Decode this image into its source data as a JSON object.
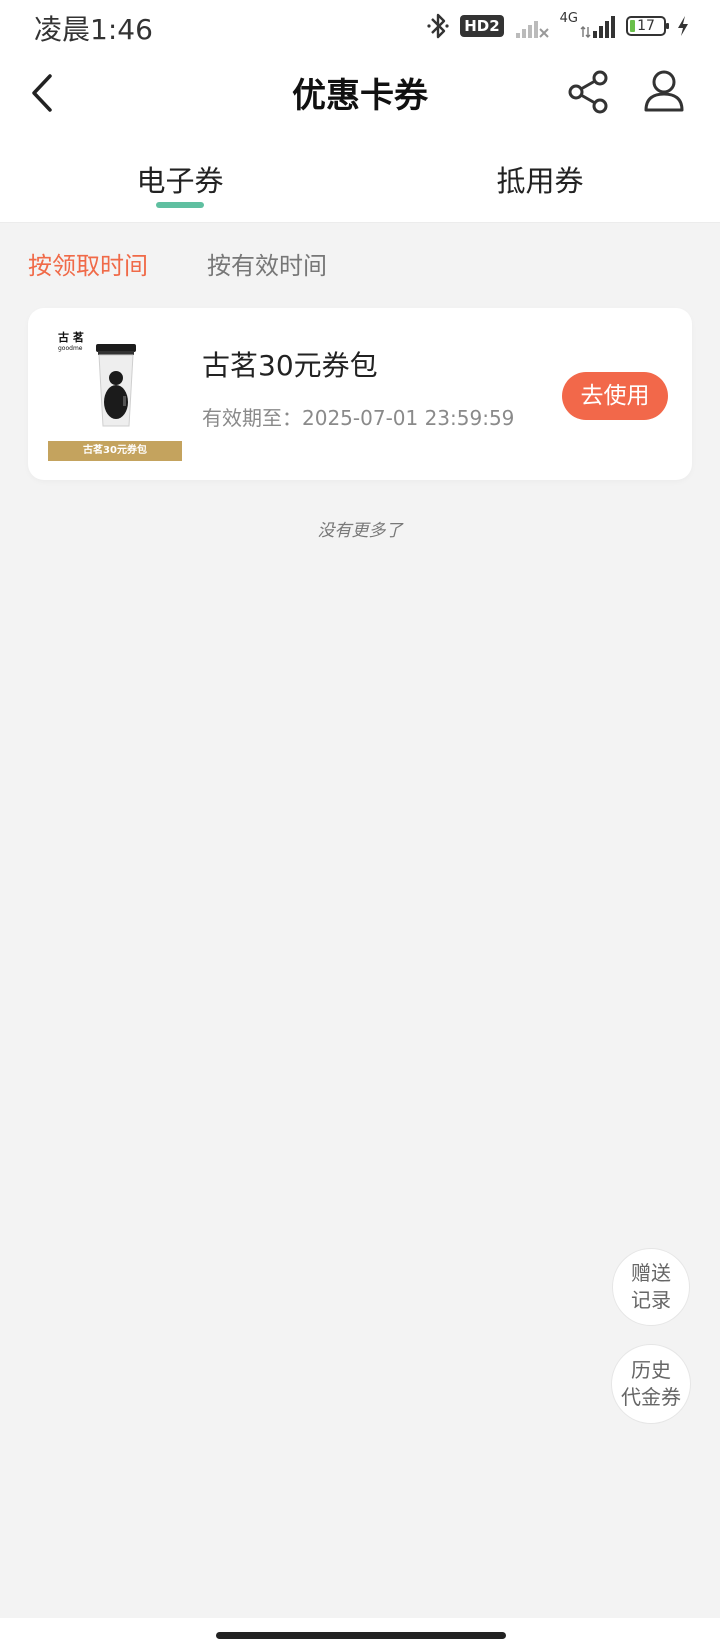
{
  "status_bar": {
    "time": "凌晨1:46",
    "hd_badge": "HD2",
    "network": "4G",
    "battery": "17",
    "icons": [
      "bluetooth-icon",
      "signal-icon",
      "battery-icon",
      "charging-icon"
    ]
  },
  "header": {
    "title": "优惠卡券",
    "icons": [
      "back-icon",
      "share-icon",
      "user-icon"
    ]
  },
  "tabs": [
    {
      "label": "电子券",
      "active": true
    },
    {
      "label": "抵用券",
      "active": false
    }
  ],
  "sort": {
    "options": [
      {
        "label": "按领取时间",
        "active": true
      },
      {
        "label": "按有效时间",
        "active": false
      }
    ]
  },
  "coupons": [
    {
      "title": "古茗30元券包",
      "expiry": "有效期至：2025-07-01 23:59:59",
      "button": "去使用",
      "thumb_brand": "古 茗",
      "thumb_brand_en": "goodme",
      "thumb_banner": "古茗30元券包"
    }
  ],
  "list_end_text": "没有更多了",
  "floating": {
    "gift_record": [
      "赠送",
      "记录"
    ],
    "history": [
      "历史",
      "代金券"
    ]
  },
  "colors": {
    "accent": "#f2684a",
    "tab_indicator": "#5fbfa0",
    "background": "#f3f3f3"
  }
}
